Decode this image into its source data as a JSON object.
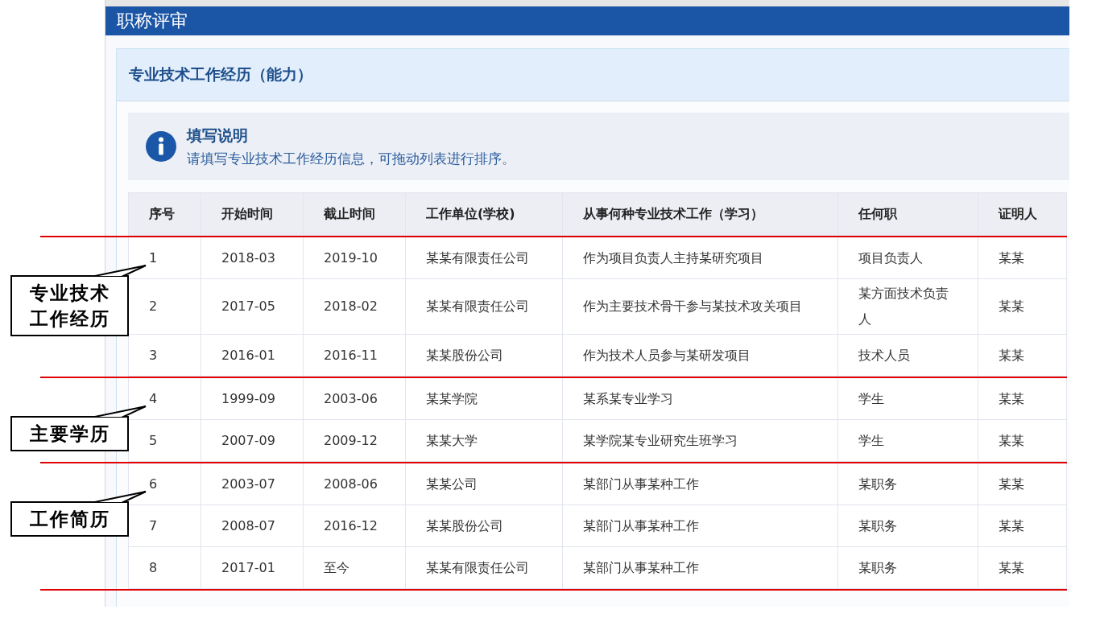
{
  "window": {
    "title": "职称评审"
  },
  "card": {
    "title": "专业技术工作经历（能力）"
  },
  "notice": {
    "title": "填写说明",
    "text": "请填写专业技术工作经历信息，可拖动列表进行排序。"
  },
  "table": {
    "columns": [
      "序号",
      "开始时间",
      "截止时间",
      "工作单位(学校)",
      "从事何种专业技术工作（学习）",
      "任何职",
      "证明人"
    ],
    "groups": [
      {
        "callout": "专业技术工作经历",
        "rows": [
          [
            "1",
            "2018-03",
            "2019-10",
            "某某有限责任公司",
            "作为项目负责人主持某研究项目",
            "项目负责人",
            "某某"
          ],
          [
            "2",
            "2017-05",
            "2018-02",
            "某某有限责任公司",
            "作为主要技术骨干参与某技术攻关项目",
            "某方面技术负责人",
            "某某"
          ],
          [
            "3",
            "2016-01",
            "2016-11",
            "某某股份公司",
            "作为技术人员参与某研发项目",
            "技术人员",
            "某某"
          ]
        ]
      },
      {
        "callout": "主要学历",
        "rows": [
          [
            "4",
            "1999-09",
            "2003-06",
            "某某学院",
            "某系某专业学习",
            "学生",
            "某某"
          ],
          [
            "5",
            "2007-09",
            "2009-12",
            "某某大学",
            "某学院某专业研究生班学习",
            "学生",
            "某某"
          ]
        ]
      },
      {
        "callout": "工作简历",
        "rows": [
          [
            "6",
            "2003-07",
            "2008-06",
            "某某公司",
            "某部门从事某种工作",
            "某职务",
            "某某"
          ],
          [
            "7",
            "2008-07",
            "2016-12",
            "某某股份公司",
            "某部门从事某种工作",
            "某职务",
            "某某"
          ],
          [
            "8",
            "2017-01",
            "至今",
            "某某有限责任公司",
            "某部门从事某种工作",
            "某职务",
            "某某"
          ]
        ]
      }
    ]
  }
}
